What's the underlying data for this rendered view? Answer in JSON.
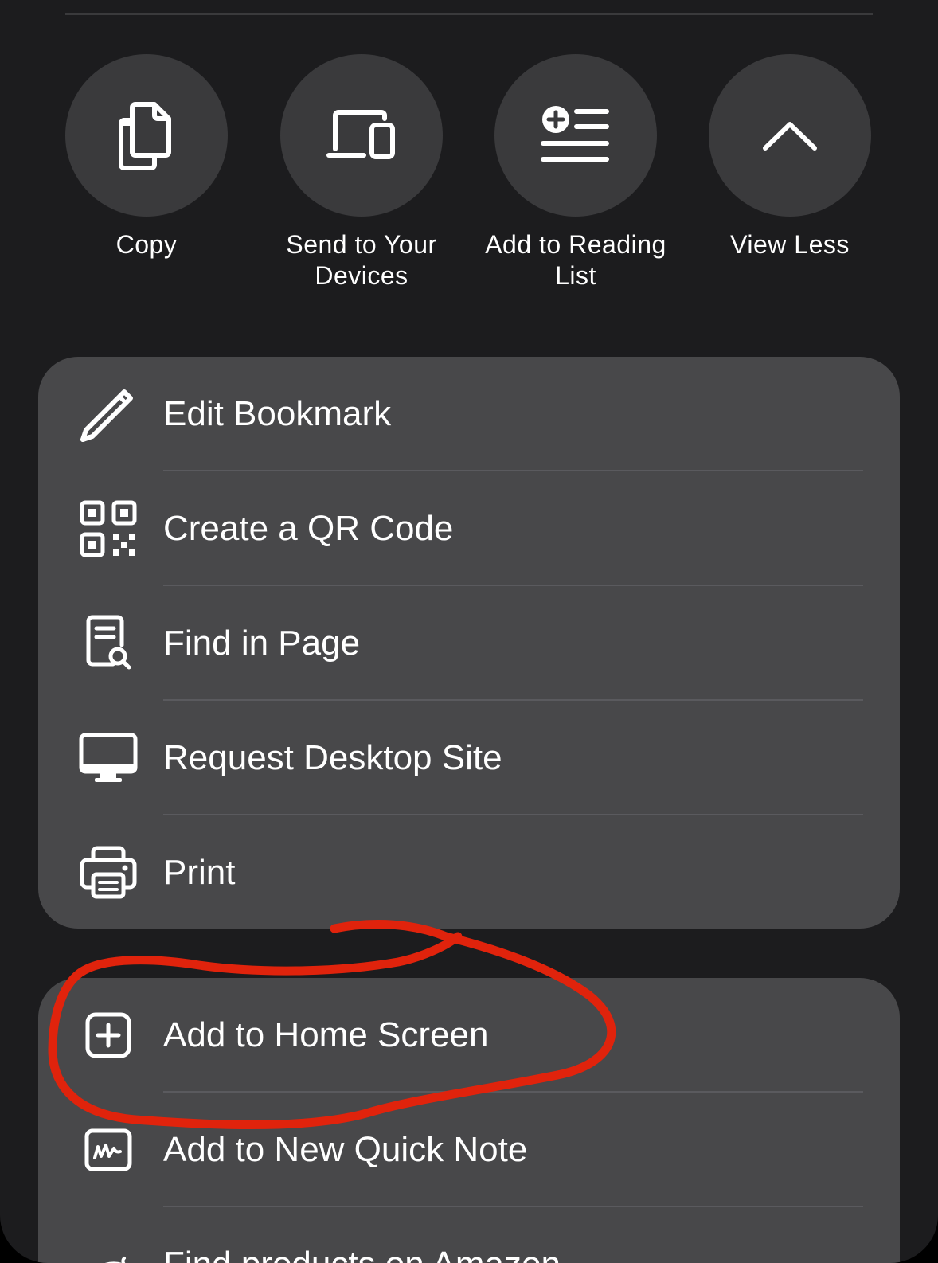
{
  "actions": [
    {
      "label": "Copy",
      "icon": "copy-icon"
    },
    {
      "label": "Send to Your Devices",
      "icon": "devices-icon"
    },
    {
      "label": "Add to Reading List",
      "icon": "reading-list-icon"
    },
    {
      "label": "View Less",
      "icon": "chevron-up-icon"
    }
  ],
  "menu_group_1": [
    {
      "label": "Edit Bookmark",
      "icon": "pencil-icon"
    },
    {
      "label": "Create a QR Code",
      "icon": "qr-code-icon"
    },
    {
      "label": "Find in Page",
      "icon": "find-in-page-icon"
    },
    {
      "label": "Request Desktop Site",
      "icon": "desktop-icon"
    },
    {
      "label": "Print",
      "icon": "printer-icon"
    }
  ],
  "menu_group_2": [
    {
      "label": "Add to Home Screen",
      "icon": "add-square-icon"
    },
    {
      "label": "Add to New Quick Note",
      "icon": "quick-note-icon"
    },
    {
      "label": "Find products on Amazon",
      "icon": "amazon-icon"
    }
  ],
  "colors": {
    "sheet_background": "#1c1c1e",
    "circle_button": "#3a3a3c",
    "menu_group": "#48484a",
    "annotation_stroke": "#e0230c"
  }
}
